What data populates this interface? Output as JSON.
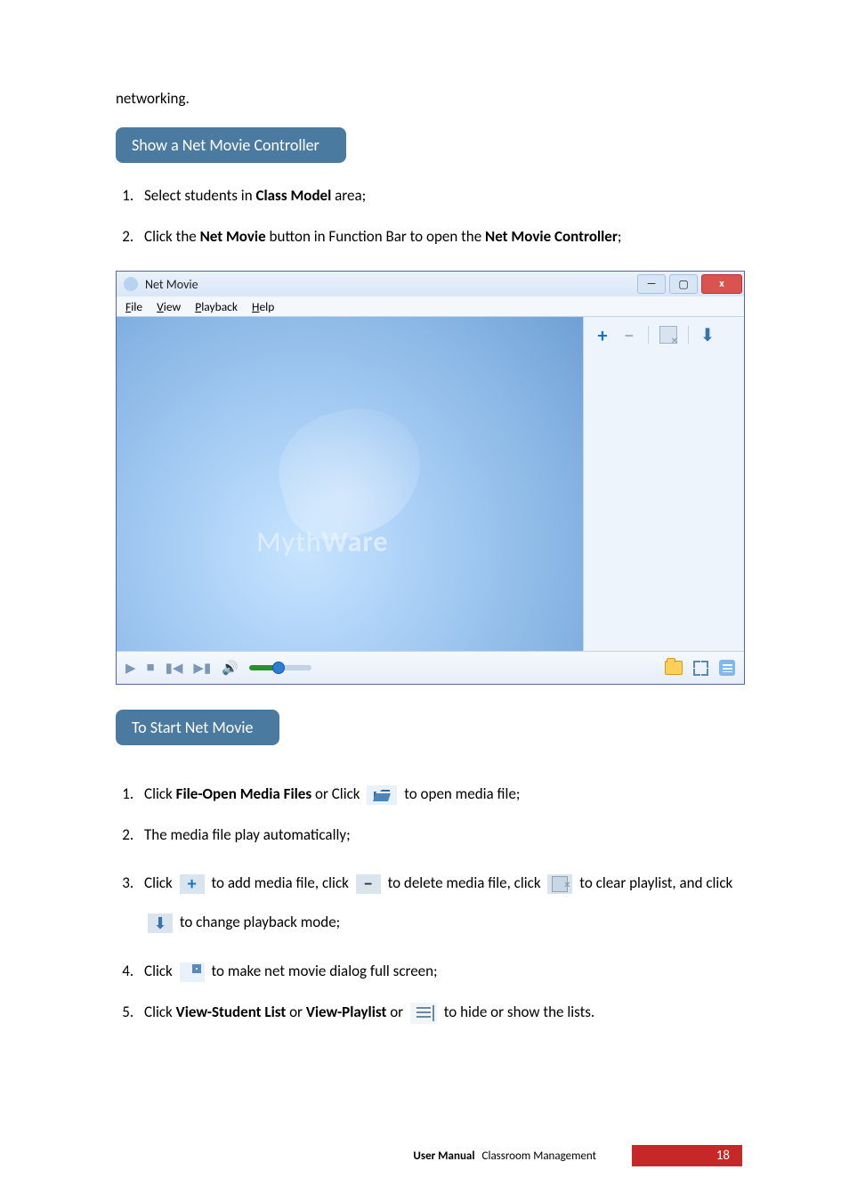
{
  "lead": "networking.",
  "heading1": "Show a Net Movie Controller",
  "steps1": [
    {
      "pre": "Select students in ",
      "bold": "Class Model",
      "post": " area;"
    },
    {
      "pre": "Click the ",
      "bold": "Net Movie",
      "mid": " button in Function Bar to open the ",
      "bold2": "Net Movie Controller",
      "post": ";"
    }
  ],
  "window": {
    "title": "Net Movie",
    "menus": {
      "file": "File",
      "view": "View",
      "playback": "Playback",
      "help": "Help"
    },
    "brand_left": "Myth",
    "brand_right": "Ware",
    "side_tools": {
      "add": "plus-icon",
      "remove": "minus-icon",
      "clear": "clear-playlist-icon",
      "mode": "playback-mode-icon"
    },
    "controls": {
      "play": "play-icon",
      "stop": "stop-icon",
      "prev": "previous-icon",
      "next": "next-icon",
      "sound": "sound-icon",
      "open": "open-folder-icon",
      "full": "fullscreen-icon",
      "list": "list-toggle-icon"
    }
  },
  "heading2": "To Start Net Movie",
  "steps2": {
    "s1a": "Click ",
    "s1b": "File-Open Media Files",
    "s1c": " or Click ",
    "s1d": " to open media file;",
    "s2": "The media file play automatically;",
    "s3a": "Click ",
    "s3b": " to add media file, click ",
    "s3c": " to delete media file, click ",
    "s3d": " to clear playlist, and click ",
    "s3e": " to change playback mode;",
    "s4a": "Click ",
    "s4b": " to make net movie dialog full screen;",
    "s5a": "Click ",
    "s5b": "View-Student List",
    "s5c": " or ",
    "s5d": "View-Playlist",
    "s5e": " or ",
    "s5f": " to hide or show the lists."
  },
  "footer": {
    "um": "User  Manual",
    "cm": "Classroom  Management",
    "page": "18"
  }
}
